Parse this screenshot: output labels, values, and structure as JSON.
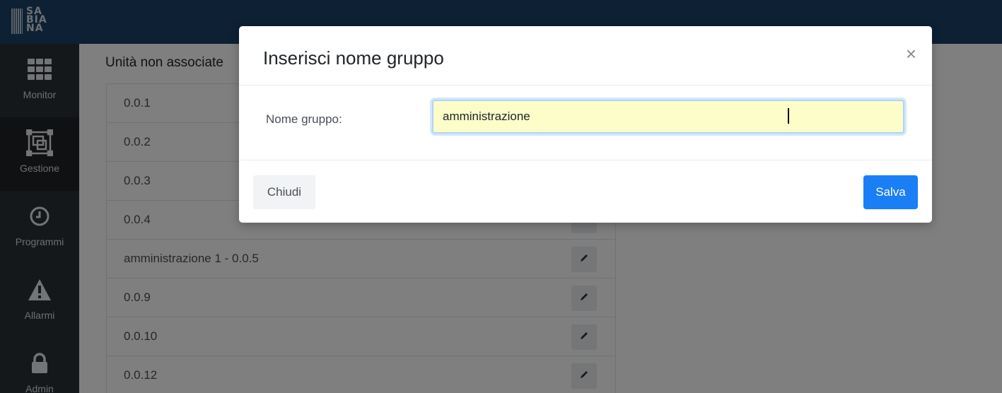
{
  "logo": {
    "lines": [
      "SA",
      "BIA",
      "NA"
    ]
  },
  "sidebar": {
    "items": [
      {
        "label": "Monitor",
        "icon": "grid-icon"
      },
      {
        "label": "Gestione",
        "icon": "frame-icon",
        "active": true
      },
      {
        "label": "Programmi",
        "icon": "clock-icon"
      },
      {
        "label": "Allarmi",
        "icon": "warning-icon"
      },
      {
        "label": "Admin",
        "icon": "lock-icon"
      }
    ]
  },
  "main": {
    "section_title": "Unità non associate",
    "rows": [
      {
        "label": "0.0.1"
      },
      {
        "label": "0.0.2"
      },
      {
        "label": "0.0.3"
      },
      {
        "label": "0.0.4"
      },
      {
        "label": "amministrazione 1 - 0.0.5"
      },
      {
        "label": "0.0.9"
      },
      {
        "label": "0.0.10"
      },
      {
        "label": "0.0.12"
      }
    ]
  },
  "modal": {
    "title": "Inserisci nome gruppo",
    "close_symbol": "×",
    "field_label": "Nome gruppo:",
    "field_value": "amministrazione",
    "close_button": "Chiudi",
    "save_button": "Salva"
  },
  "colors": {
    "header": "#1b4068",
    "sidebar": "#2b3136",
    "primary": "#1a7ff5",
    "input_bg": "#fcfdc9"
  }
}
